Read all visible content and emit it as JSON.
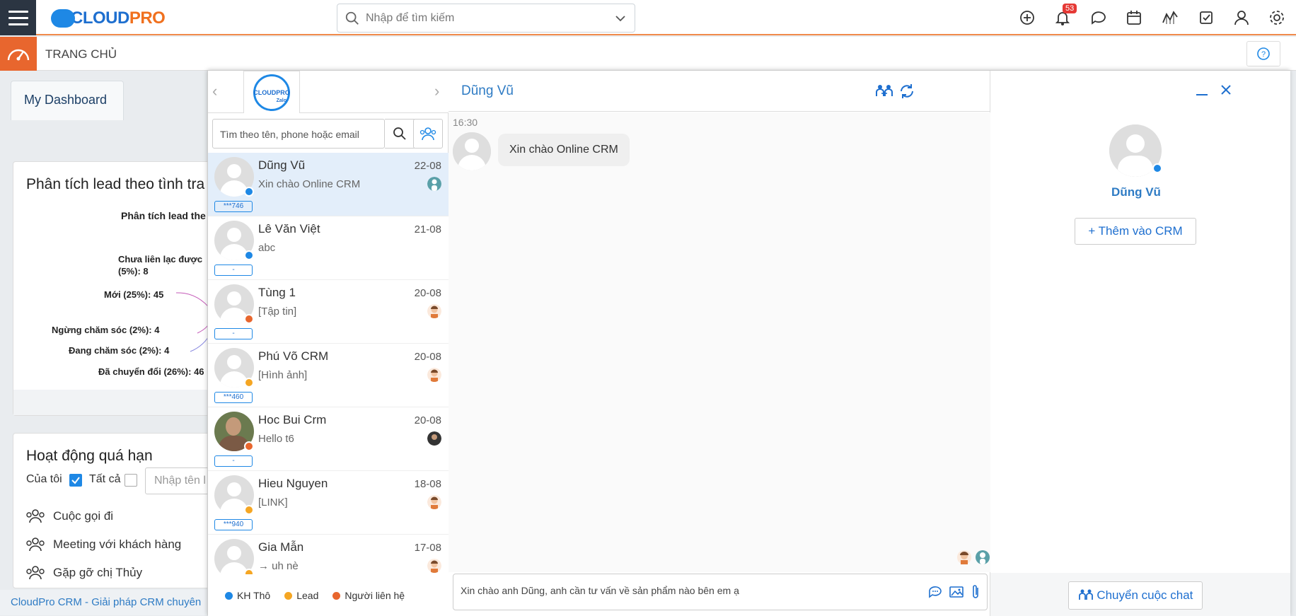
{
  "app": {
    "logo_text_1": "CLOUD",
    "logo_text_2": "PRO",
    "search_placeholder": "Nhập để tìm kiếm",
    "notification_count": "53",
    "page_title": "TRANG CHỦ"
  },
  "dashboard": {
    "tab_label": "My Dashboard",
    "lead_card": {
      "title": "Phân tích lead theo tình tra",
      "chart_title": "Phân tích lead the",
      "labels": [
        "Chưa liên lạc được",
        "(5%): 8",
        "Mới (25%): 45",
        "Ngừng chăm sóc (2%): 4",
        "Đang chăm sóc (2%): 4",
        "Đã chuyển đổi (26%): 46"
      ]
    },
    "overdue_card": {
      "title": "Hoạt động quá hạn",
      "mine_label": "Của tôi",
      "all_label": "Tất cả",
      "input_placeholder": "Nhập tên l",
      "activities": [
        "Cuộc gọi đi",
        "Meeting với khách hàng",
        "Gặp gỡ chị Thủy"
      ]
    },
    "footer": "CloudPro CRM - Giải pháp CRM chuyên"
  },
  "zalo": {
    "oa_logo_text": "CLOUDPRO",
    "oa_logo_sub": "Zalo",
    "search_placeholder": "Tìm theo tên, phone hoặc email",
    "conversations": [
      {
        "name": "Dũng Vũ",
        "message": "Xin chào Online CRM",
        "date": "22-08",
        "tag": "***746",
        "status_color": "#1e88e5",
        "active": true
      },
      {
        "name": "Lê Văn Việt",
        "message": "abc",
        "date": "21-08",
        "tag": "-",
        "status_color": "#1e88e5",
        "active": false
      },
      {
        "name": "Tùng 1",
        "message": "[Tập tin]",
        "date": "20-08",
        "tag": "-",
        "status_color": "#e8662e",
        "active": false
      },
      {
        "name": "Phú Võ CRM",
        "message": "[Hình ảnh]",
        "date": "20-08",
        "tag": "***460",
        "status_color": "#f5a623",
        "active": false
      },
      {
        "name": "Hoc Bui Crm",
        "message": "Hello t6",
        "date": "20-08",
        "tag": "-",
        "status_color": "#e8662e",
        "active": false
      },
      {
        "name": "Hieu Nguyen",
        "message": "[LINK]",
        "date": "18-08",
        "tag": "***940",
        "status_color": "#f5a623",
        "active": false
      },
      {
        "name": "Gia Mẫn",
        "message": "→ uh nè",
        "date": "17-08",
        "tag": "",
        "status_color": "#f5a623",
        "active": false
      }
    ],
    "legend": [
      {
        "label": "KH Thô",
        "color": "#1e88e5"
      },
      {
        "label": "Lead",
        "color": "#f5a623"
      },
      {
        "label": "Người liên hệ",
        "color": "#e8662e"
      }
    ],
    "chat": {
      "contact_name": "Dũng Vũ",
      "time": "16:30",
      "message": "Xin chào Online CRM",
      "composer_text": "Xin chào anh Dũng, anh cần tư vấn về sản phẩm nào bên em ạ"
    },
    "profile": {
      "name": "Dũng Vũ",
      "add_button": "Thêm vào CRM",
      "transfer_button": "Chuyển cuộc chat"
    }
  }
}
